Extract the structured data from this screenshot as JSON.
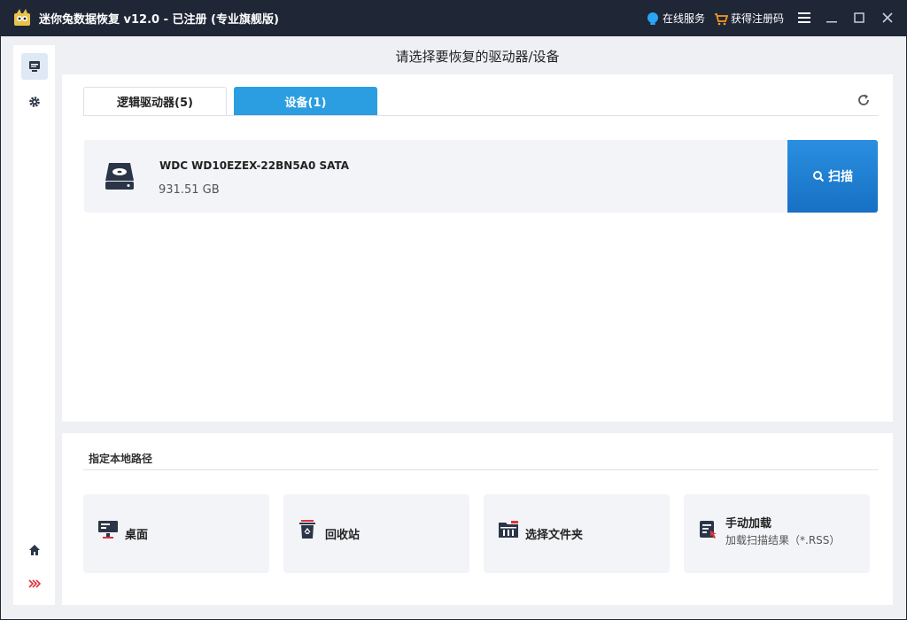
{
  "titlebar": {
    "title": "迷你兔数据恢复 v12.0 - 已注册 (专业旗舰版)",
    "online_service": "在线服务",
    "get_code": "获得注册码",
    "menu_icon": "hamburger-icon",
    "minimize_icon": "minimize-icon",
    "maximize_icon": "maximize-icon",
    "close_icon": "close-icon"
  },
  "sidebar": {
    "items": [
      {
        "icon": "drive-recovery-icon",
        "active": true
      },
      {
        "icon": "gear-icon",
        "active": false
      },
      {
        "icon": "home-icon",
        "active": false
      },
      {
        "icon": "expand-chevrons-icon",
        "active": false
      }
    ]
  },
  "main": {
    "heading": "请选择要恢复的驱动器/设备",
    "tabs": [
      {
        "label": "逻辑驱动器(5)",
        "active": false
      },
      {
        "label": "设备(1)",
        "active": true
      }
    ],
    "devices": [
      {
        "name": "WDC WD10EZEX-22BN5A0 SATA",
        "size": "931.51 GB",
        "scan_label": "扫描"
      }
    ]
  },
  "local_path": {
    "title": "指定本地路径",
    "cards": [
      {
        "label": "桌面",
        "icon": "desktop-icon"
      },
      {
        "label": "回收站",
        "icon": "recycle-bin-icon"
      },
      {
        "label": "选择文件夹",
        "icon": "folder-icon"
      },
      {
        "label": "手动加载",
        "sub": "加载扫描结果（*.RSS）",
        "icon": "manual-load-icon"
      }
    ]
  },
  "colors": {
    "titlebar_bg": "#1f2636",
    "accent": "#2a9ee0",
    "scan_button": "#1770c4"
  }
}
